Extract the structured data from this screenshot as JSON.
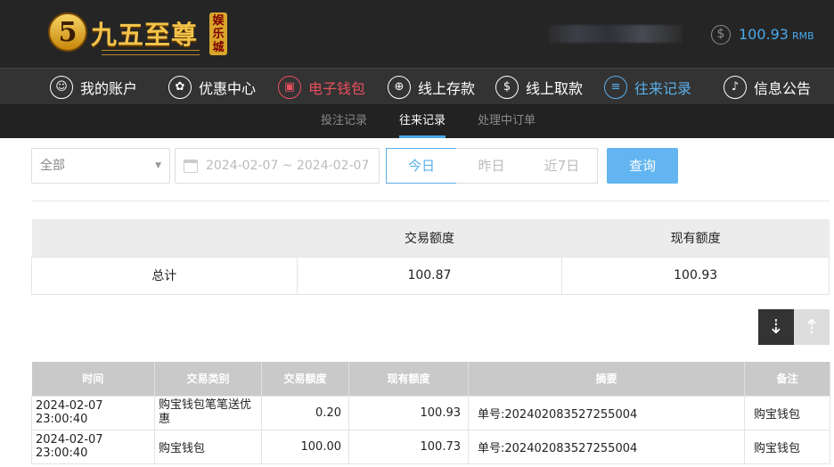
{
  "brand": {
    "logo_numeral": "5",
    "name": "九五至尊",
    "badge": "娱乐城"
  },
  "account": {
    "balance": "100.93",
    "currency": "RMB",
    "dollar_glyph": "$"
  },
  "nav": {
    "items": [
      {
        "label": "我的账户",
        "icon": "user-icon",
        "glyph": "☺"
      },
      {
        "label": "优惠中心",
        "icon": "gift-icon",
        "glyph": "✿"
      },
      {
        "label": "电子钱包",
        "icon": "wallet-icon",
        "glyph": "▣"
      },
      {
        "label": "线上存款",
        "icon": "deposit-icon",
        "glyph": "⊕"
      },
      {
        "label": "线上取款",
        "icon": "withdraw-icon",
        "glyph": "$"
      },
      {
        "label": "往来记录",
        "icon": "records-icon",
        "glyph": "≡"
      },
      {
        "label": "信息公告",
        "icon": "bell-icon",
        "glyph": "♪"
      }
    ]
  },
  "subnav": {
    "tabs": [
      {
        "label": "投注记录"
      },
      {
        "label": "往来记录"
      },
      {
        "label": "处理中订单"
      }
    ]
  },
  "filter": {
    "type_select": "全部",
    "date_range": "2024-02-07 ~ 2024-02-07",
    "quick": {
      "today": "今日",
      "yesterday": "昨日",
      "last7": "近7日"
    },
    "search_label": "查询"
  },
  "summary": {
    "headers": [
      "",
      "交易额度",
      "现有额度"
    ],
    "row": [
      "总计",
      "100.87",
      "100.93"
    ]
  },
  "records": {
    "headers": [
      "时间",
      "交易类别",
      "交易额度",
      "现有额度",
      "摘要",
      "备注"
    ],
    "rows": [
      [
        "2024-02-07 23:00:40",
        "购宝钱包笔笔送优惠",
        "0.20",
        "100.93",
        "单号:202402083527255004",
        "购宝钱包"
      ],
      [
        "2024-02-07 23:00:40",
        "购宝钱包",
        "100.00",
        "100.73",
        "单号:202402083527255004",
        "购宝钱包"
      ]
    ]
  },
  "colors": {
    "accent_blue": "#4aa9ec",
    "active_red": "#e94f5e",
    "gold": "#f3c24a"
  }
}
